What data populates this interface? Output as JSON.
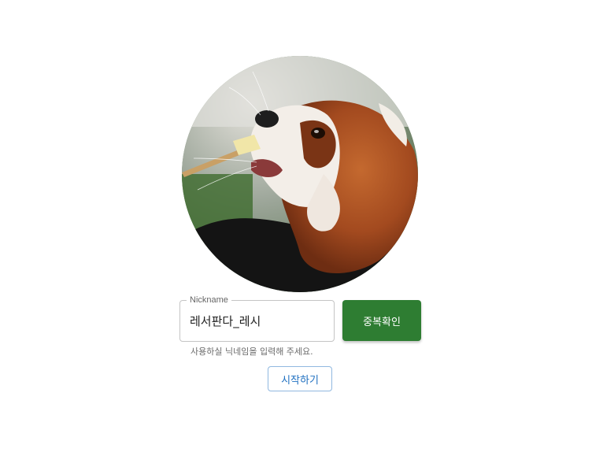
{
  "profile": {
    "avatar_alt": "red panda"
  },
  "nickname": {
    "label": "Nickname",
    "value": "레서판다_레시",
    "helper": "사용하실 닉네임을 입력해 주세요."
  },
  "buttons": {
    "check_duplicate": "중복확인",
    "start": "시작하기"
  },
  "colors": {
    "primary_green": "#2e7d32",
    "start_text": "#1e6fc0",
    "start_border": "#90b8e0",
    "field_border": "#c4c4c4"
  }
}
